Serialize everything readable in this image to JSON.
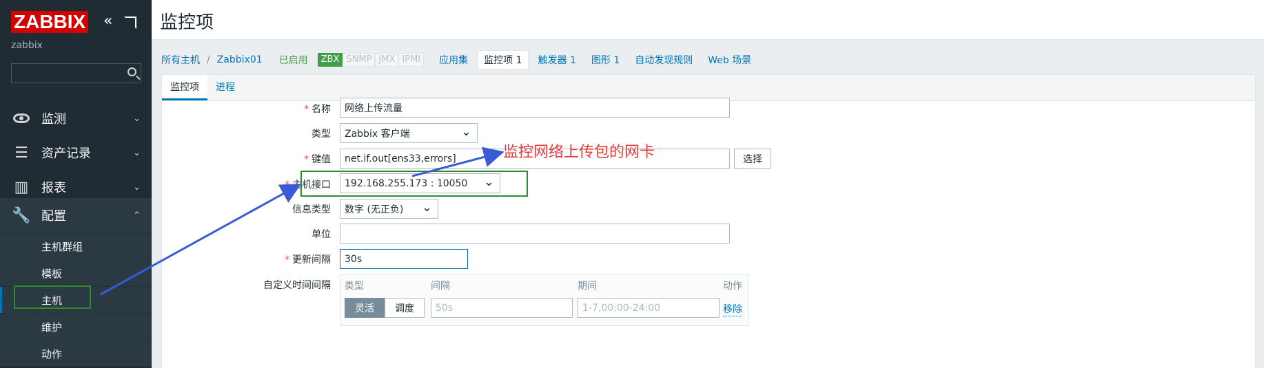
{
  "sidebar": {
    "logo": "ZABBIX",
    "server_name": "zabbix",
    "menu": [
      {
        "label": "监测",
        "icon": "eye-icon"
      },
      {
        "label": "资产记录",
        "icon": "list-icon"
      },
      {
        "label": "报表",
        "icon": "bar-chart-icon"
      },
      {
        "label": "配置",
        "icon": "wrench-icon"
      }
    ],
    "submenu": [
      "主机群组",
      "模板",
      "主机",
      "维护",
      "动作"
    ]
  },
  "header": {
    "title": "监控项"
  },
  "breadcrumb": {
    "all_hosts": "所有主机",
    "separator": "/",
    "host": "Zabbix01",
    "status": "已启用",
    "availability": [
      "ZBX",
      "SNMP",
      "JMX",
      "IPMI"
    ],
    "tabs": [
      {
        "label": "应用集",
        "count": ""
      },
      {
        "label": "监控项",
        "count": "1"
      },
      {
        "label": "触发器",
        "count": "1"
      },
      {
        "label": "图形",
        "count": "1"
      },
      {
        "label": "自动发现规则",
        "count": ""
      },
      {
        "label": "Web 场景",
        "count": ""
      }
    ]
  },
  "form_tabs": [
    "监控项",
    "进程"
  ],
  "form": {
    "name_label": "名称",
    "name_value": "网络上传流量",
    "type_label": "类型",
    "type_value": "Zabbix 客户端",
    "key_label": "键值",
    "key_value": "net.if.out[ens33,errors]",
    "key_button": "选择",
    "interface_label": "主机接口",
    "interface_value": "192.168.255.173 : 10050",
    "info_type_label": "信息类型",
    "info_type_value": "数字 (无正负)",
    "units_label": "单位",
    "units_value": "",
    "interval_label": "更新间隔",
    "interval_value": "30s",
    "custom_label": "自定义时间间隔",
    "custom_table": {
      "headers": [
        "类型",
        "间隔",
        "期间",
        "动作"
      ],
      "modes": [
        "灵活",
        "调度"
      ],
      "interval_placeholder": "50s",
      "period_placeholder": "1-7,00:00-24:00",
      "remove": "移除"
    }
  },
  "annotation": {
    "text": "监控网络上传包的网卡",
    "color": "#e33c3c"
  },
  "colors": {
    "sidebar": "#1f2c33",
    "link": "#0275b8",
    "enabled": "#429e47",
    "logo": "#d40000"
  }
}
